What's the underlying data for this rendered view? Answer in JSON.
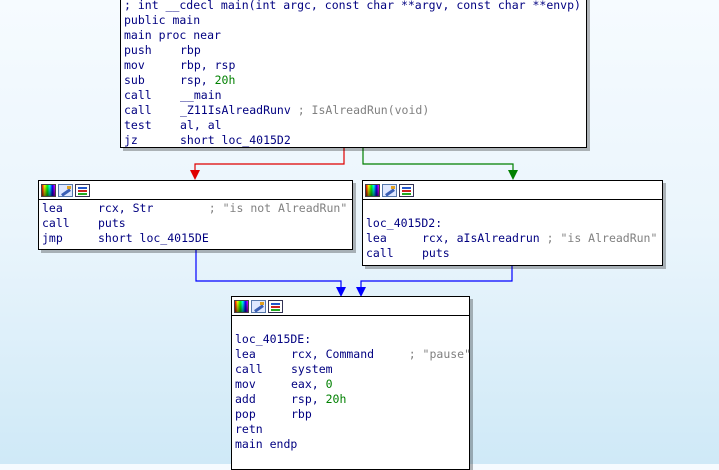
{
  "main_block": {
    "lines": [
      {
        "text": "; int __cdecl main(int argc, const char **argv, const char **envp)"
      },
      {
        "text": "public main"
      },
      {
        "text": "main proc near"
      },
      {
        "mn": "push",
        "op": "rbp"
      },
      {
        "mn": "mov",
        "op": "rbp, rsp"
      },
      {
        "mn": "sub",
        "op": "rsp, ",
        "num": "20h"
      },
      {
        "mn": "call",
        "op": "__main"
      },
      {
        "mn": "call",
        "op": "_Z11IsAlreadRunv",
        "cmt": " ; IsAlreadRun(void)"
      },
      {
        "mn": "test",
        "op": "al, al"
      },
      {
        "mn": "jz",
        "op": "short loc_4015D2"
      }
    ]
  },
  "left_block": {
    "lines": [
      {
        "mn": "lea",
        "op": "rcx, Str",
        "cmt": "        ; \"is not AlreadRun\""
      },
      {
        "mn": "call",
        "op": "puts"
      },
      {
        "mn": "jmp",
        "op": "short loc_4015DE"
      }
    ]
  },
  "right_block": {
    "lines": [
      {
        "text": ""
      },
      {
        "text": "loc_4015D2:"
      },
      {
        "mn": "lea",
        "op": "rcx, aIsAlreadrun",
        "cmt": " ; \"is AlreadRun\""
      },
      {
        "mn": "call",
        "op": "puts"
      }
    ]
  },
  "bottom_block": {
    "lines": [
      {
        "text": ""
      },
      {
        "text": "loc_4015DE:"
      },
      {
        "mn": "lea",
        "op": "rcx, Command",
        "cmt": "     ; \"pause\""
      },
      {
        "mn": "call",
        "op": "system"
      },
      {
        "mn": "mov",
        "op": "eax, ",
        "num": "0"
      },
      {
        "mn": "add",
        "op": "rsp, ",
        "num": "20h"
      },
      {
        "mn": "pop",
        "op": "rbp"
      },
      {
        "mn": "retn"
      },
      {
        "text": "main endp"
      }
    ]
  },
  "colors": {
    "edge_false": "#e00000",
    "edge_true": "#008000",
    "edge_jump": "#0000ff",
    "text": "#000080",
    "number": "#008000",
    "comment": "#808080"
  },
  "icons": [
    "color-palette-icon",
    "rename-icon",
    "graph-overview-icon"
  ]
}
